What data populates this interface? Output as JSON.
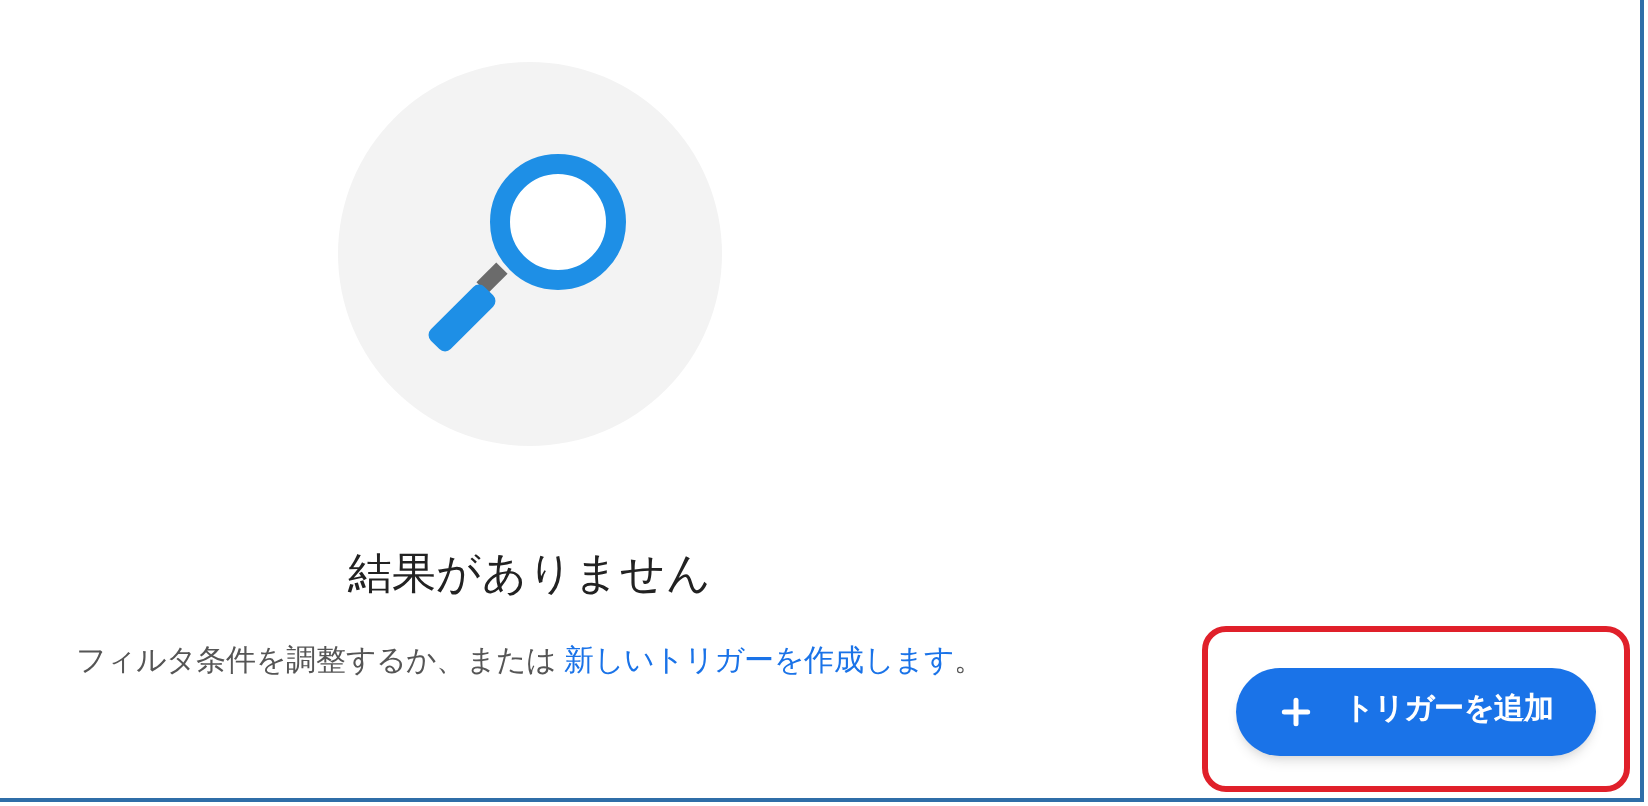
{
  "empty_state": {
    "title": "結果がありません",
    "message": "フィルタ条件を調整するか、または ",
    "link": "新しいトリガーを作成します",
    "message_end": "。"
  },
  "add_button": {
    "label": "トリガーを追加",
    "highlighted": true
  }
}
